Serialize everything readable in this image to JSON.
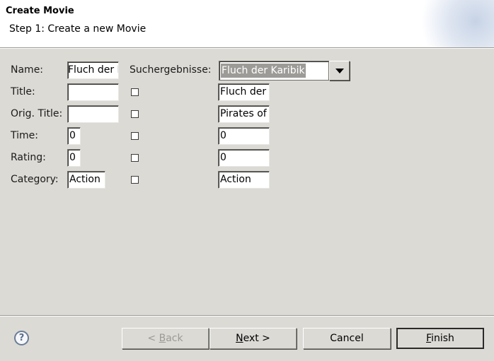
{
  "wizard": {
    "title": "Create Movie",
    "subtitle": "Step 1: Create a new Movie"
  },
  "form": {
    "name_label": "Name:",
    "name_value": "Fluch der Karibik",
    "search_label": "Suchergebnisse:",
    "search_selected": "Fluch der Karibik",
    "rows": [
      {
        "label": "Title:",
        "value": "",
        "checked": false,
        "result": "Fluch der Karibik"
      },
      {
        "label": "Orig. Title:",
        "value": "",
        "checked": false,
        "result": "Pirates of the Caribbean"
      },
      {
        "label": "Time:",
        "value": "0",
        "checked": false,
        "result": "0"
      },
      {
        "label": "Rating:",
        "value": "0",
        "checked": false,
        "result": "0"
      },
      {
        "label": "Category:",
        "value": "Action",
        "checked": false,
        "result": "Action"
      }
    ]
  },
  "buttons": {
    "back": {
      "prefix": "< ",
      "mnemonic": "B",
      "rest": "ack"
    },
    "next": {
      "prefix": "",
      "mnemonic": "N",
      "rest": "ext >"
    },
    "cancel": "Cancel",
    "finish": {
      "prefix": "",
      "mnemonic": "F",
      "rest": "inish"
    }
  },
  "icons": {
    "help": "help-icon"
  },
  "colors": {
    "background": "#dcdad5",
    "selection": "#9d9b98"
  }
}
